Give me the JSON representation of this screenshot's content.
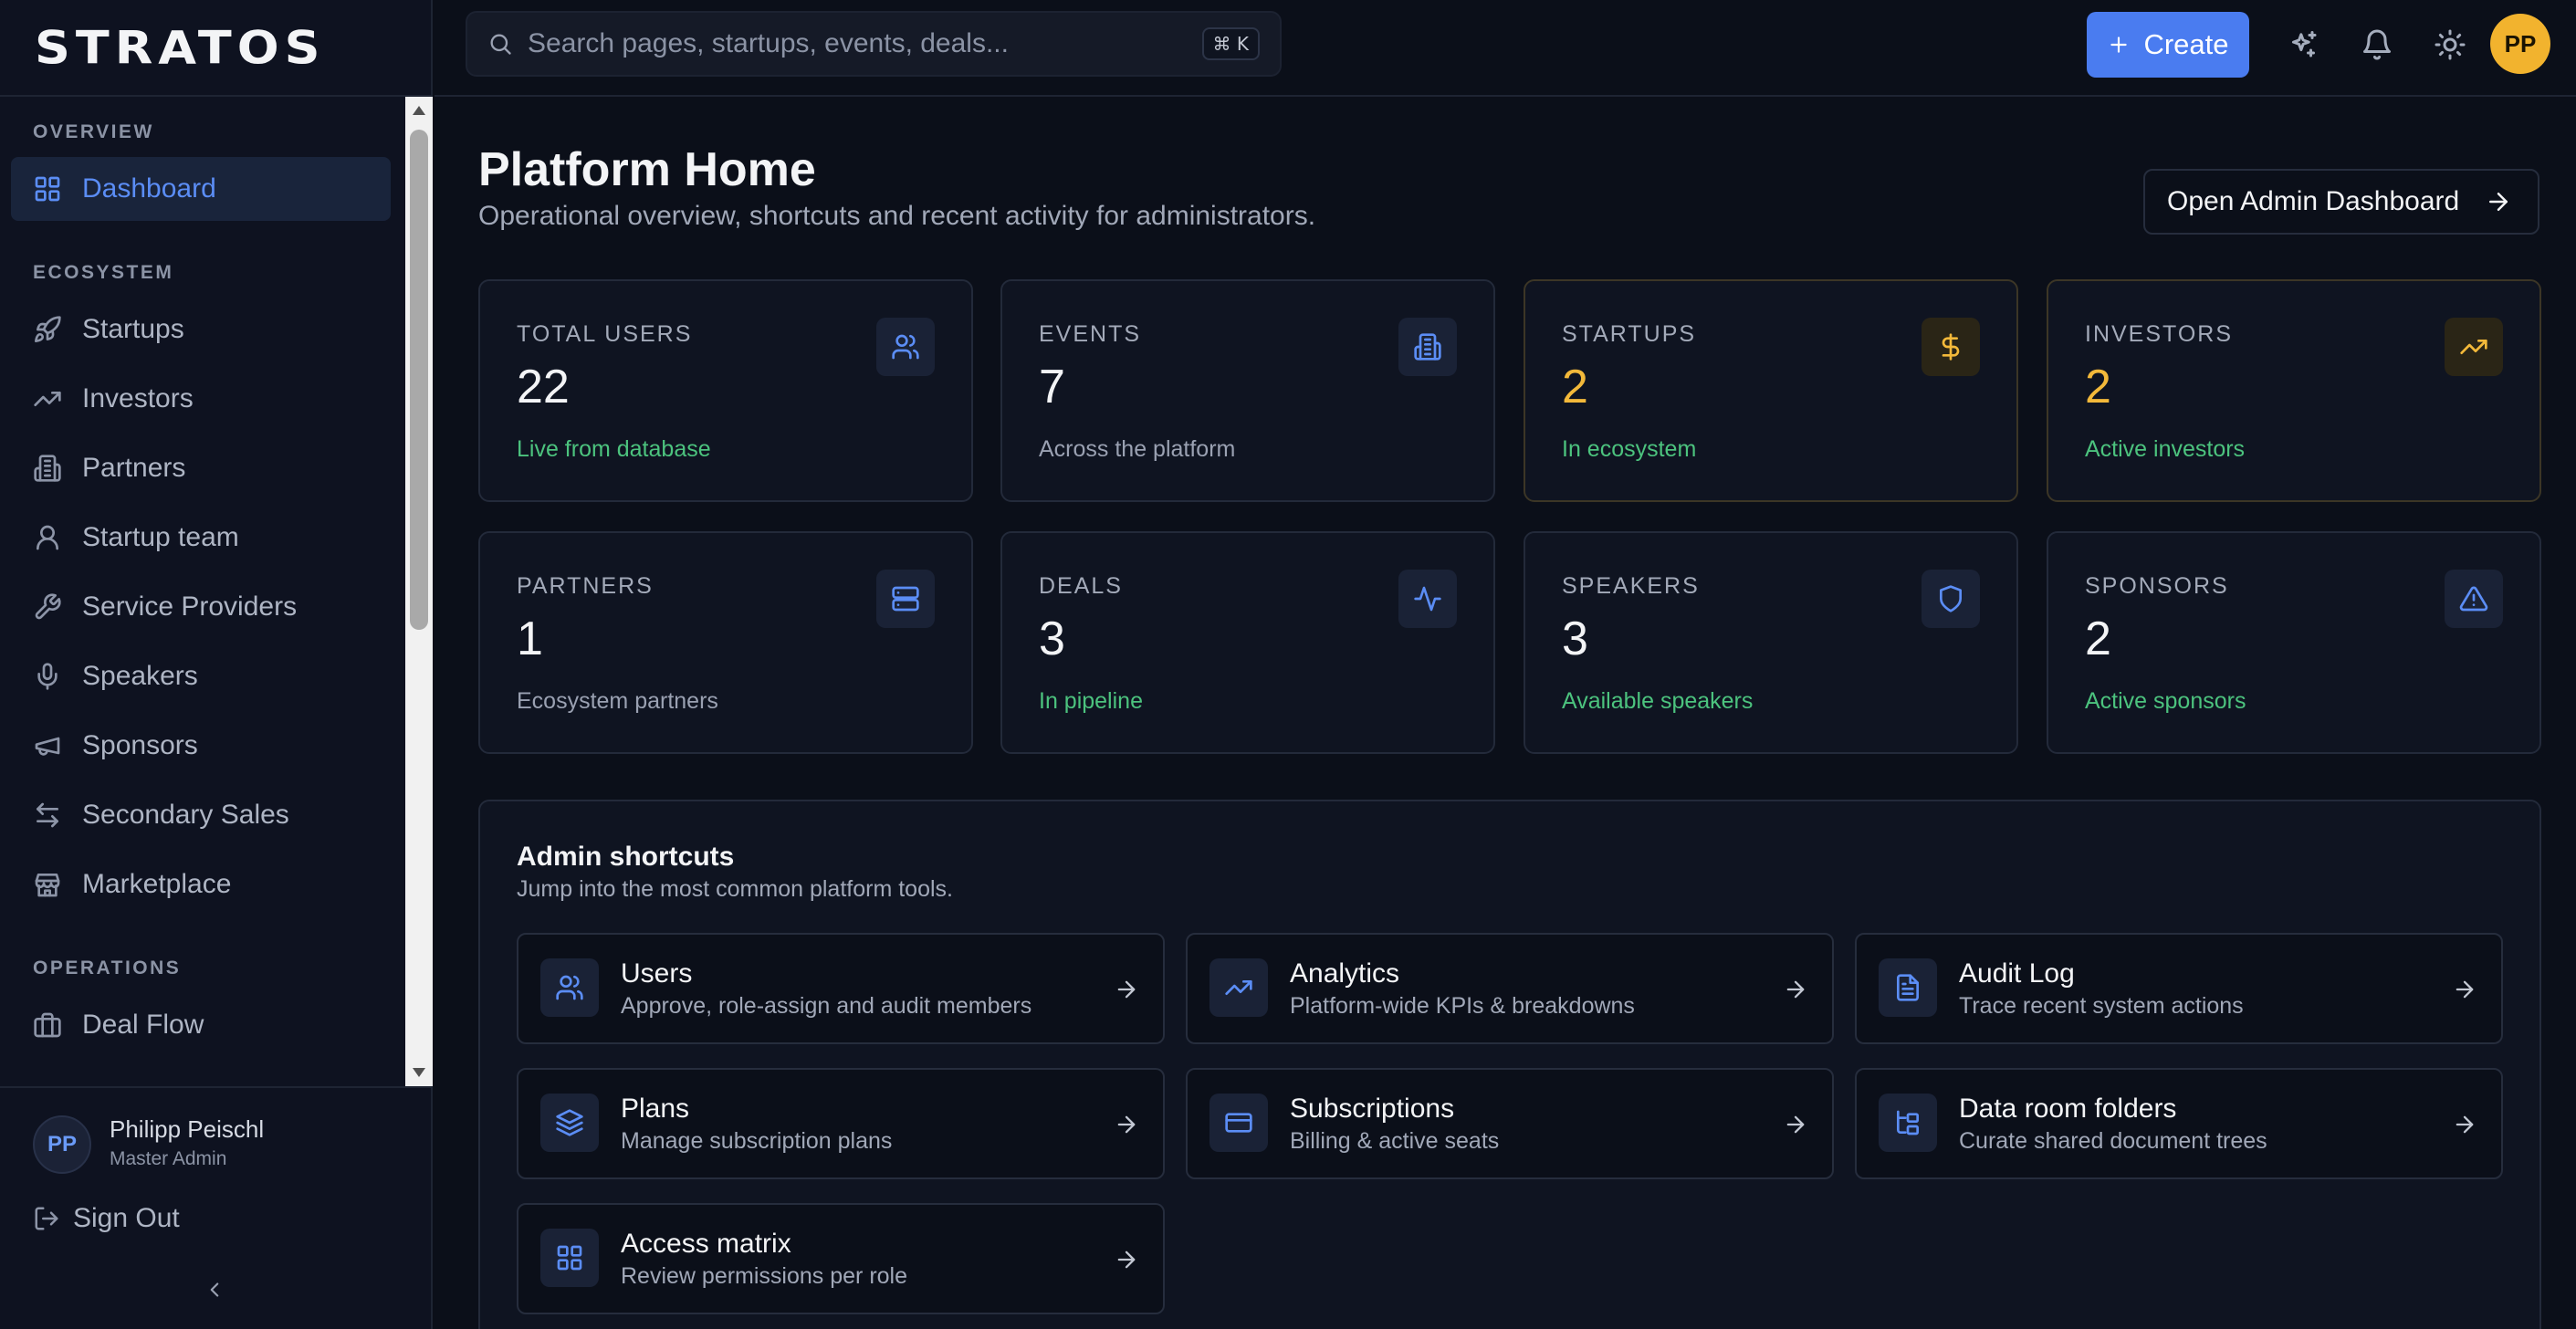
{
  "app": {
    "brand": "STRATOS"
  },
  "sidebar": {
    "sections": {
      "overview": "OVERVIEW",
      "ecosystem": "ECOSYSTEM",
      "operations": "OPERATIONS"
    },
    "items": [
      {
        "label": "Dashboard",
        "icon": "layout-grid-icon",
        "active": true
      },
      {
        "label": "Startups",
        "icon": "rocket-icon"
      },
      {
        "label": "Investors",
        "icon": "trending-up-icon"
      },
      {
        "label": "Partners",
        "icon": "building-icon"
      },
      {
        "label": "Startup team",
        "icon": "user-icon"
      },
      {
        "label": "Service Providers",
        "icon": "wrench-icon"
      },
      {
        "label": "Speakers",
        "icon": "microphone-icon"
      },
      {
        "label": "Sponsors",
        "icon": "megaphone-icon"
      },
      {
        "label": "Secondary Sales",
        "icon": "arrows-left-right-icon"
      },
      {
        "label": "Marketplace",
        "icon": "store-icon"
      },
      {
        "label": "Deal Flow",
        "icon": "briefcase-icon"
      }
    ],
    "user": {
      "initials": "PP",
      "name": "Philipp Peischl",
      "role": "Master Admin"
    },
    "sign_out": "Sign Out"
  },
  "topbar": {
    "search_placeholder": "Search pages, startups, events, deals...",
    "shortcut": "⌘ K",
    "create_label": "Create",
    "avatar_initials": "PP"
  },
  "header": {
    "title": "Platform Home",
    "subtitle": "Operational overview, shortcuts and recent activity for administrators.",
    "admin_button": "Open Admin Dashboard"
  },
  "stats": [
    {
      "label": "TOTAL USERS",
      "value": "22",
      "note": "Live from database",
      "icon": "users-icon"
    },
    {
      "label": "EVENTS",
      "value": "7",
      "note": "Across the platform",
      "icon": "building-icon"
    },
    {
      "label": "STARTUPS",
      "value": "2",
      "note": "In ecosystem",
      "icon": "dollar-icon"
    },
    {
      "label": "INVESTORS",
      "value": "2",
      "note": "Active investors",
      "icon": "trending-up-icon"
    },
    {
      "label": "PARTNERS",
      "value": "1",
      "note": "Ecosystem partners",
      "icon": "server-icon"
    },
    {
      "label": "DEALS",
      "value": "3",
      "note": "In pipeline",
      "icon": "activity-icon"
    },
    {
      "label": "SPEAKERS",
      "value": "3",
      "note": "Available speakers",
      "icon": "shield-icon"
    },
    {
      "label": "SPONSORS",
      "value": "2",
      "note": "Active sponsors",
      "icon": "alert-triangle-icon"
    }
  ],
  "shortcuts": {
    "title": "Admin shortcuts",
    "subtitle": "Jump into the most common platform tools.",
    "items": [
      {
        "name": "Users",
        "desc": "Approve, role-assign and audit members",
        "icon": "users-icon"
      },
      {
        "name": "Analytics",
        "desc": "Platform-wide KPIs & breakdowns",
        "icon": "trending-up-icon"
      },
      {
        "name": "Audit Log",
        "desc": "Trace recent system actions",
        "icon": "file-text-icon"
      },
      {
        "name": "Plans",
        "desc": "Manage subscription plans",
        "icon": "layers-icon"
      },
      {
        "name": "Subscriptions",
        "desc": "Billing & active seats",
        "icon": "credit-card-icon"
      },
      {
        "name": "Data room folders",
        "desc": "Curate shared document trees",
        "icon": "folder-tree-icon"
      },
      {
        "name": "Access matrix",
        "desc": "Review permissions per role",
        "icon": "layout-grid-icon"
      }
    ]
  },
  "colors": {
    "accent": "#4a7cf0",
    "gold": "#f3b93a",
    "green": "#4cc37e",
    "background": "#0b0f19"
  }
}
